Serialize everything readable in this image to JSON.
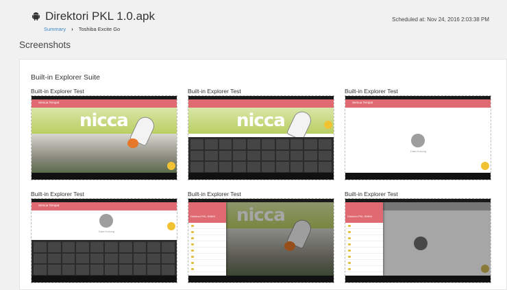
{
  "app": {
    "title": "Direktori PKL 1.0.apk",
    "icon": "android-icon"
  },
  "breadcrumb": {
    "summary": "Summary",
    "separator": "›",
    "device": "Toshiba Excite Go"
  },
  "schedule": {
    "text": "Scheduled at: Nov 24, 2016 2:03:38 PM"
  },
  "section": {
    "title": "Screenshots"
  },
  "suite": {
    "title": "Built-in Explorer Suite",
    "screenshots": [
      {
        "label": "Built-in Explorer Test",
        "toolbar": "Semua Tempat"
      },
      {
        "label": "Built-in Explorer Test",
        "toolbar": ""
      },
      {
        "label": "Built-in Explorer Test",
        "toolbar": "Semua Tempat",
        "empty": "Data Kosong"
      },
      {
        "label": "Built-in Explorer Test",
        "toolbar": "Semua Tempat",
        "empty": "Data Kosong"
      },
      {
        "label": "Built-in Explorer Test",
        "drawer": "Direktori PKL SMKN"
      },
      {
        "label": "Built-in Explorer Test",
        "drawer": "Direktori PKL SMKN"
      }
    ]
  },
  "colors": {
    "toolbar": "#e06a72",
    "link": "#3b86c8",
    "fab": "#f1c232"
  }
}
